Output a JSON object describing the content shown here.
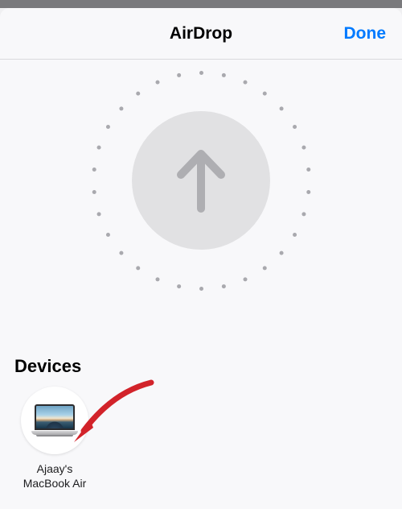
{
  "header": {
    "title": "AirDrop",
    "done_label": "Done"
  },
  "radar": {
    "icon": "arrow-up-icon"
  },
  "devices": {
    "title": "Devices",
    "items": [
      {
        "label_line1": "Ajaay's",
        "label_line2": "MacBook Air",
        "icon": "macbook-icon"
      }
    ]
  },
  "colors": {
    "accent": "#007aff",
    "annotation": "#d2232a"
  }
}
